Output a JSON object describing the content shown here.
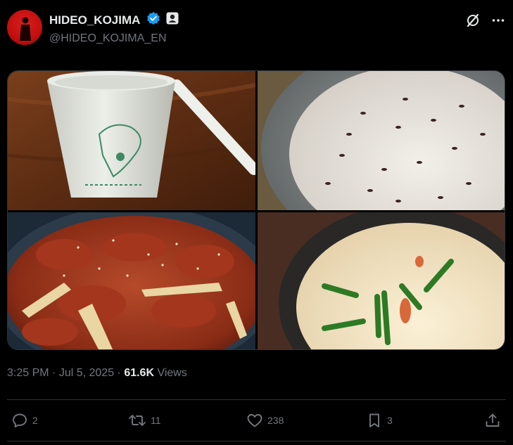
{
  "author": {
    "display_name": "HIDEO_KOJIMA",
    "handle": "@HIDEO_KOJIMA_EN",
    "verified": true
  },
  "post": {
    "time": "3:25 PM",
    "separator": " · ",
    "date": "Jul 5, 2025",
    "views_count": "61.6K",
    "views_label": "Views"
  },
  "media": [
    {
      "name": "photo-makgeolli-cup"
    },
    {
      "name": "photo-mixed-grain-rice"
    },
    {
      "name": "photo-spicy-pork"
    },
    {
      "name": "photo-steamed-egg"
    }
  ],
  "actions": {
    "replies": "2",
    "reposts": "11",
    "likes": "238",
    "bookmarks": "3"
  },
  "colors": {
    "background": "#000000",
    "text": "#e7e9ea",
    "muted": "#71767b",
    "verified": "#1d9bf0",
    "border": "#2f3336"
  }
}
